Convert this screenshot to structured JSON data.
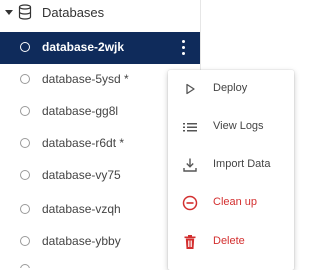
{
  "tree": {
    "title": "Databases",
    "items": [
      {
        "label": "database-2wjk",
        "selected": true
      },
      {
        "label": "database-5ysd  *"
      },
      {
        "label": "database-gg8l"
      },
      {
        "label": "database-r6dt  *"
      },
      {
        "label": "database-vy75"
      },
      {
        "label": "database-vzqh"
      },
      {
        "label": "database-ybby"
      }
    ]
  },
  "menu": {
    "items": [
      {
        "label": "Deploy",
        "icon": "play-icon"
      },
      {
        "label": "View Logs",
        "icon": "list-icon"
      },
      {
        "label": "Import Data",
        "icon": "download-icon"
      },
      {
        "label": "Clean up",
        "icon": "minus-circle-icon",
        "danger": true
      },
      {
        "label": "Delete",
        "icon": "trash-icon",
        "danger": true
      }
    ]
  },
  "colors": {
    "selected_bg": "#0f2b5b",
    "danger": "#d32f2f",
    "text": "#444444"
  }
}
